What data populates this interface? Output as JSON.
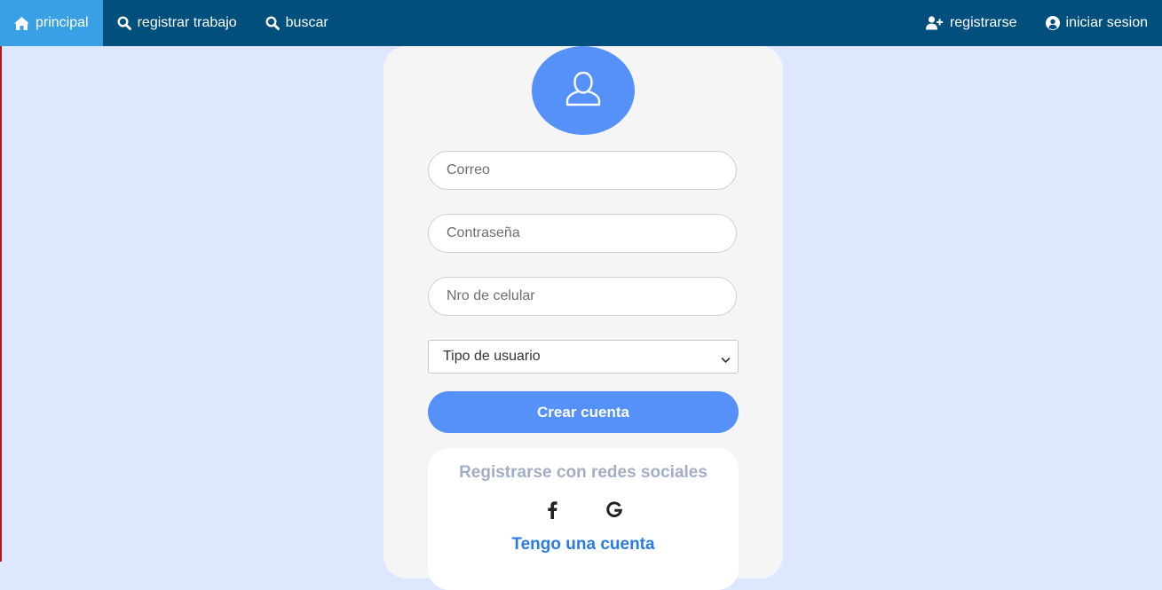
{
  "navbar": {
    "left_items": [
      {
        "label": "principal",
        "icon": "home-icon",
        "active": true
      },
      {
        "label": "registrar trabajo",
        "icon": "search-icon"
      },
      {
        "label": "buscar",
        "icon": "search-icon"
      }
    ],
    "right_items": [
      {
        "label": "registrarse",
        "icon": "user-plus-icon"
      },
      {
        "label": "iniciar sesion",
        "icon": "user-circle-icon"
      }
    ]
  },
  "form": {
    "avatar_icon": "user-icon",
    "email_placeholder": "Correo",
    "password_placeholder": "Contraseña",
    "phone_placeholder": "Nro de celular",
    "user_type_selected": "Tipo de usuario",
    "create_button": "Crear cuenta"
  },
  "social": {
    "title": "Registrarse con redes sociales",
    "icons": [
      "facebook-icon",
      "google-icon"
    ],
    "have_account_link": "Tengo una cuenta"
  },
  "colors": {
    "navbar_bg": "#004f7c",
    "nav_active": "#3aa0e6",
    "page_bg": "#dde7fd",
    "accent_blue": "#5591f9",
    "link_blue": "#2a7be4"
  }
}
